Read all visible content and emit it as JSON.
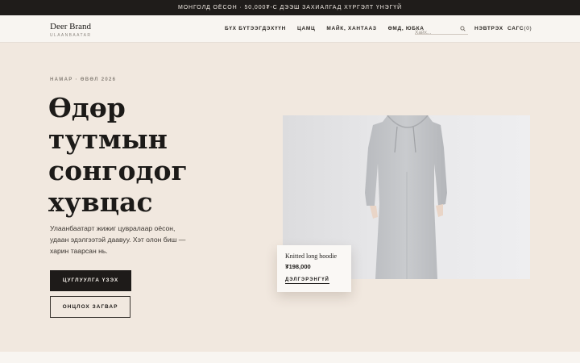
{
  "announcement": "МОНГОЛД ОЁСОН · 50,000₮-С ДЭЭШ ЗАХИАЛГАД ХҮРГЭЛТ ҮНЭГҮЙ",
  "header": {
    "brand_name": "Deer Brand",
    "brand_city": "ULAANBAATAR",
    "nav": [
      {
        "label": "БҮХ БҮТЭЭГДЭХҮҮН"
      },
      {
        "label": "ЦАМЦ"
      },
      {
        "label": "МАЙК, ХАНТААЗ"
      },
      {
        "label": "ӨМД, ЮБКА"
      }
    ],
    "search_placeholder": "Хайх...",
    "login_label": "НЭВТРЭХ",
    "cart_label": "САГС",
    "cart_count": "(0)"
  },
  "hero": {
    "kicker": "НАМАР · ӨВӨЛ 2026",
    "headline": "Өдөр тутмын сонгодог хувцас",
    "intro": "Улаанбаатарт жижиг цувралаар оёсон, удаан эдэлгээтэй даавуу. Хэт олон биш — харин таарсан нь.",
    "primary_cta": "ЦУГЛУУЛГА ҮЗЭХ",
    "secondary_cta": "ОНЦЛОХ ЗАГВАР"
  },
  "featured": {
    "name": "Knitted long hoodie",
    "price": "₮198,000",
    "link": "ДЭЛГЭРЭНГҮЙ"
  },
  "colors": {
    "background": "#f1e8df",
    "topbar": "#1f1c1a",
    "header": "#f8f5f1",
    "primary_button": "#1e1b19"
  }
}
